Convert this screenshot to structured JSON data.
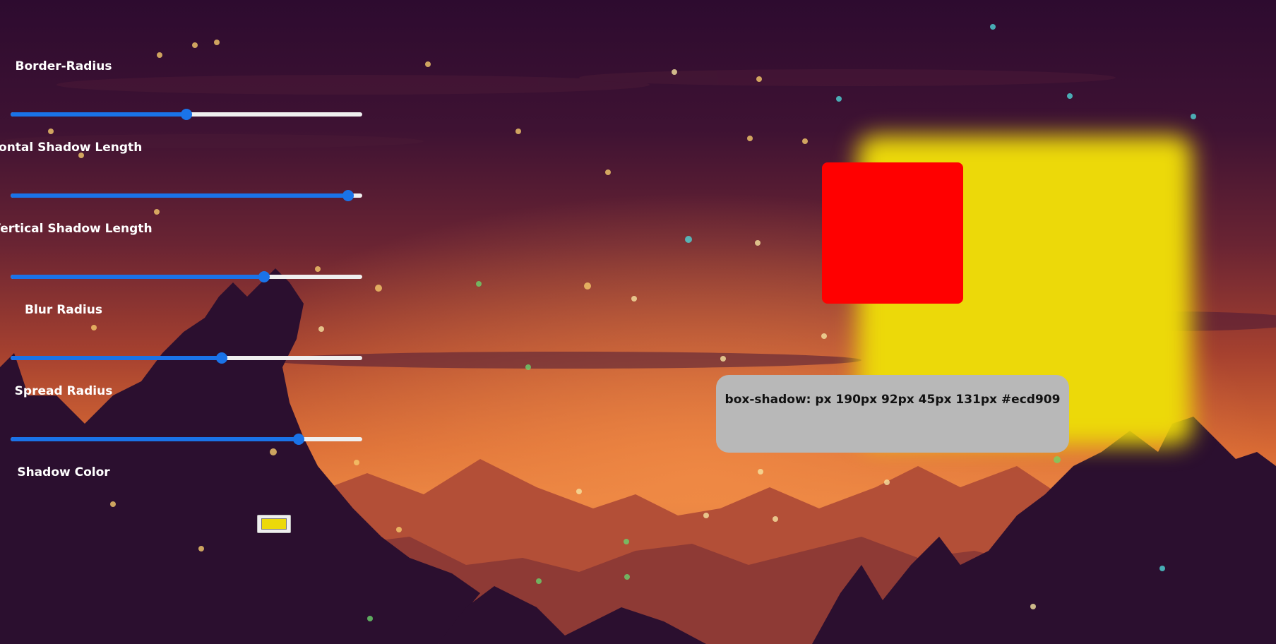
{
  "controls": {
    "border_radius": {
      "label": "Border-Radius",
      "value_fraction": 0.5
    },
    "horizontal_shadow": {
      "label": "Horizontal Shadow Length",
      "value_fraction": 0.96
    },
    "vertical_shadow": {
      "label": "Vertical Shadow Length",
      "value_fraction": 0.72
    },
    "blur_radius": {
      "label": "Blur Radius",
      "value_fraction": 0.6
    },
    "spread_radius": {
      "label": "Spread Radius",
      "value_fraction": 0.82
    },
    "shadow_color": {
      "label": "Shadow Color",
      "value": "#ecd909"
    }
  },
  "preview": {
    "box_color": "#ff0000",
    "shadow_color": "#ecd909"
  },
  "output": {
    "text": "box-shadow: px 190px 92px 45px 131px #ecd909"
  },
  "colors": {
    "slider_accent": "#1a73e8",
    "slider_track": "#efefef",
    "code_bg": "#b8b8b8"
  }
}
